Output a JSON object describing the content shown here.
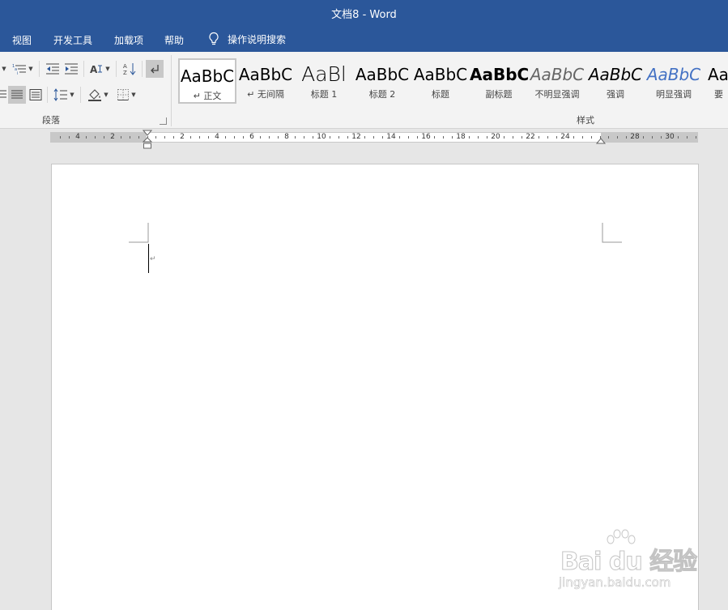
{
  "window": {
    "title": "文档8  -  Word"
  },
  "menu": {
    "tabs": [
      "视图",
      "开发工具",
      "加载项",
      "帮助"
    ],
    "tell_me": "操作说明搜索"
  },
  "ribbon": {
    "paragraph_group_label": "段落",
    "styles_group_label": "样式",
    "styles": [
      {
        "sample": "AaBbC",
        "name": "↵ 正文"
      },
      {
        "sample": "AaBbC",
        "name": "↵ 无间隔"
      },
      {
        "sample": "AaBl",
        "name": "标题 1"
      },
      {
        "sample": "AaBbC",
        "name": "标题 2"
      },
      {
        "sample": "AaBbC",
        "name": "标题"
      },
      {
        "sample": "AaBbC",
        "name": "副标题"
      },
      {
        "sample": "AaBbC",
        "name": "不明显强调"
      },
      {
        "sample": "AaBbC",
        "name": "强调"
      },
      {
        "sample": "AaBbC",
        "name": "明显强调"
      },
      {
        "sample": "Aa",
        "name": "要"
      }
    ]
  },
  "ruler": {
    "labels": [
      "4",
      "2",
      "2",
      "4",
      "6",
      "8",
      "10",
      "12",
      "14",
      "16",
      "18",
      "20",
      "22",
      "24",
      "28",
      "30"
    ]
  },
  "document": {
    "paragraph_mark": "↵"
  },
  "watermark": {
    "brand": "Bai du 经验",
    "url": "jingyan.baidu.com"
  }
}
